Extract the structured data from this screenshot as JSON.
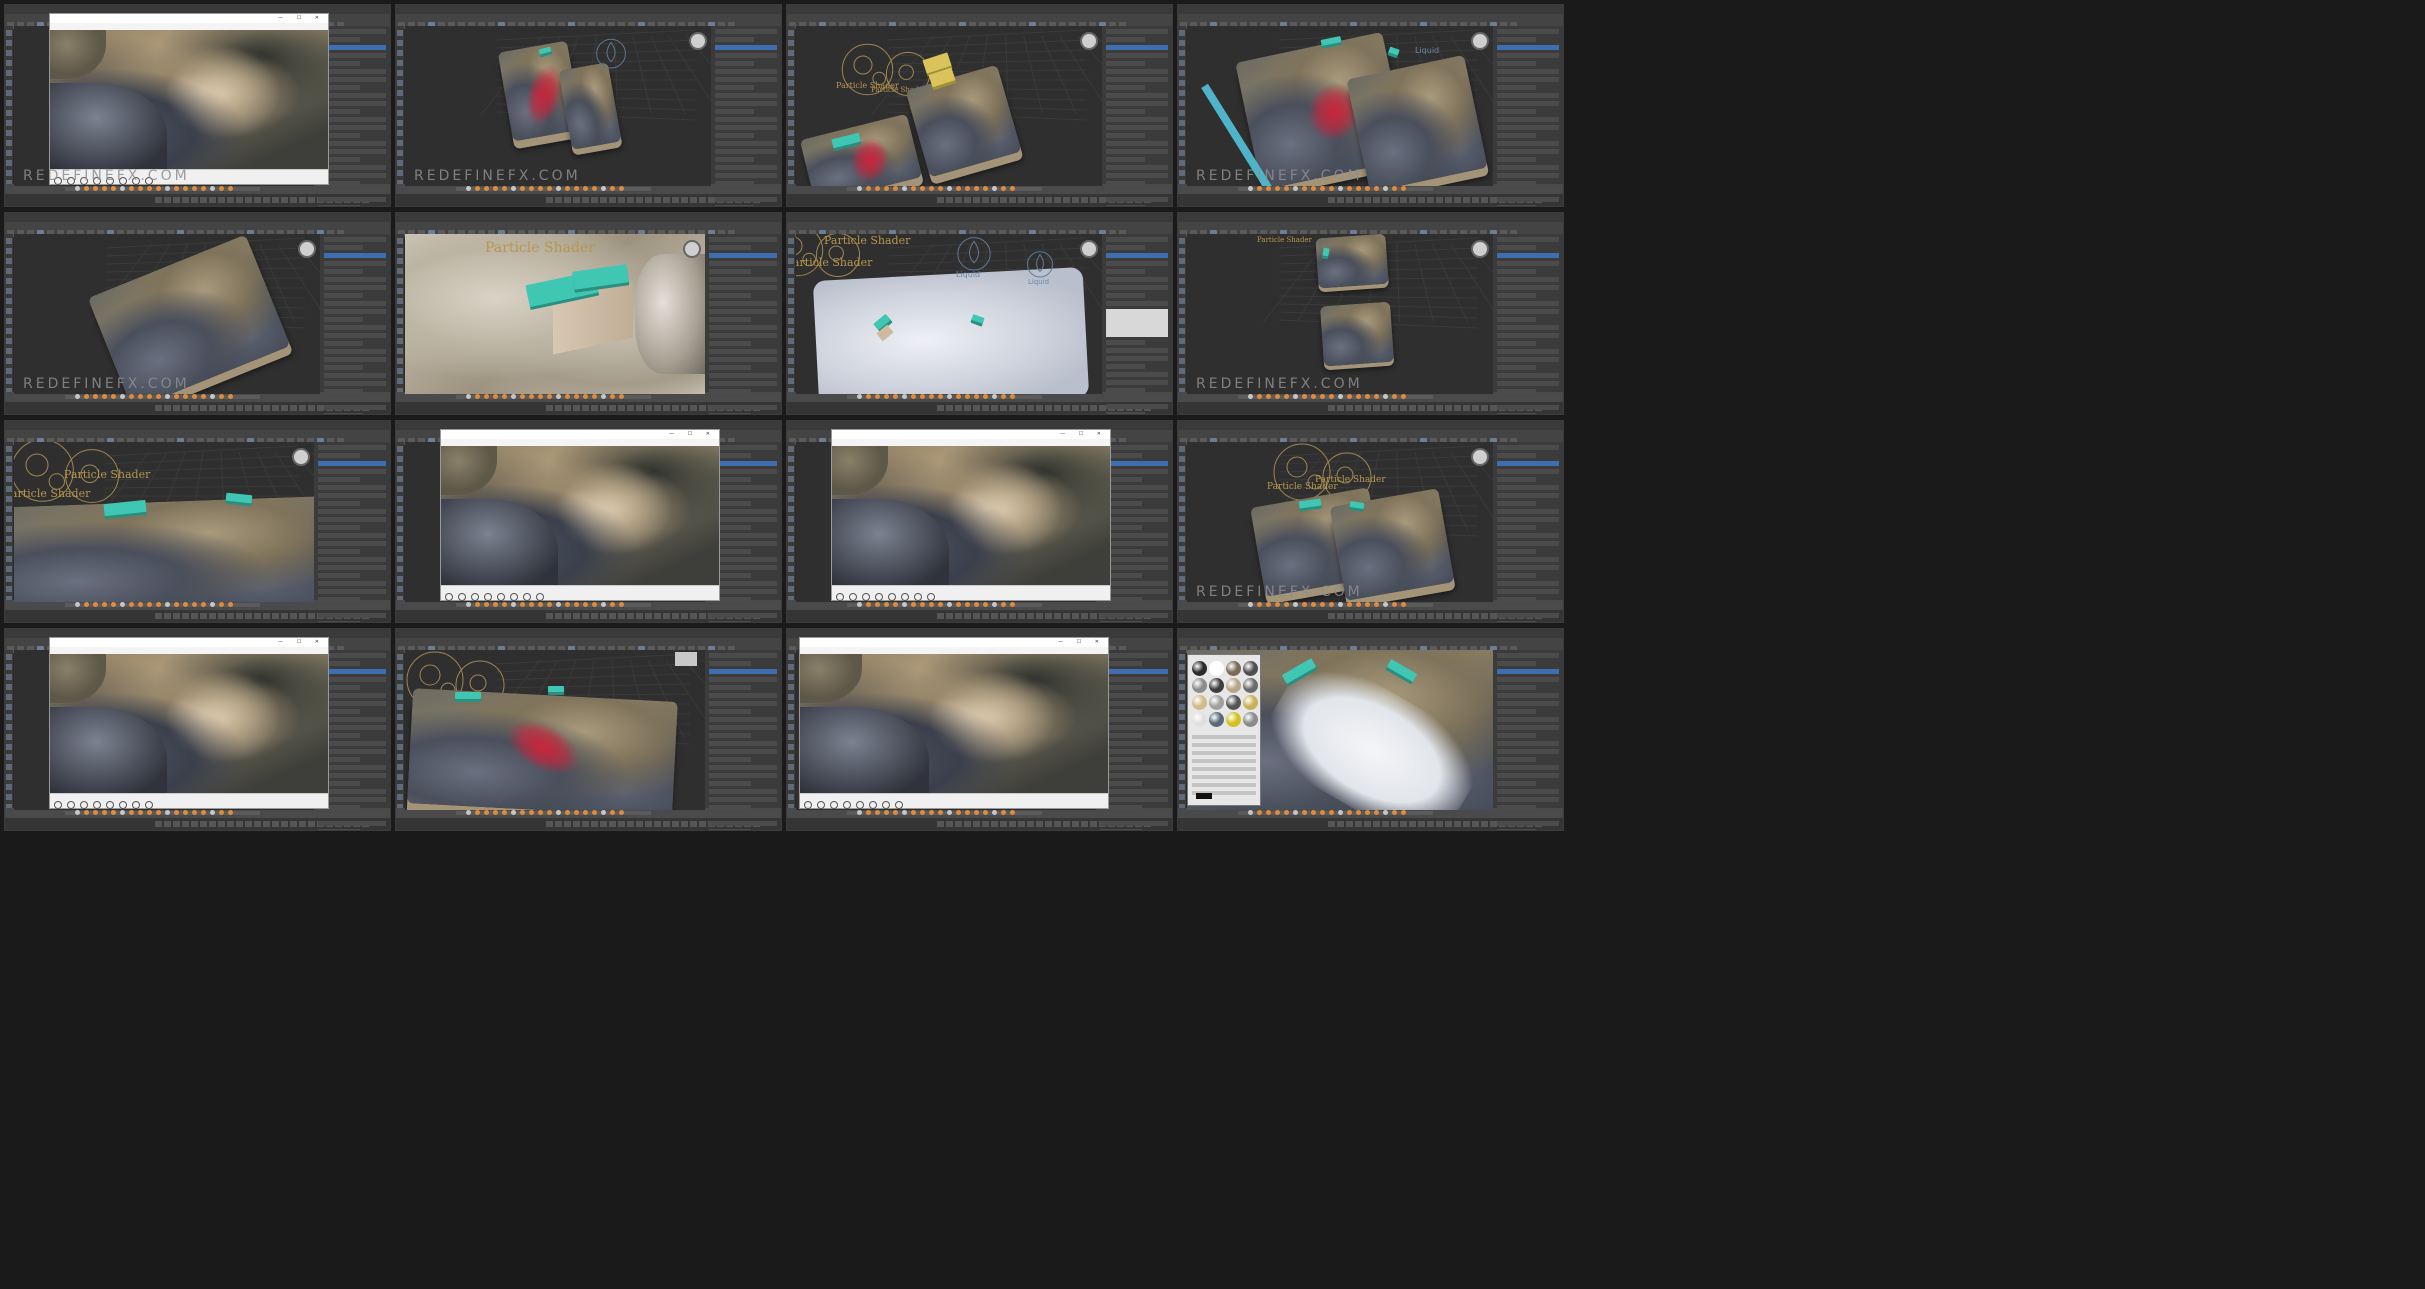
{
  "menu": [
    "File",
    "Edit",
    "Tools",
    "Group",
    "Views",
    "Create",
    "Modifiers",
    "Animation",
    "Graph Editors",
    "Rendering",
    "Civil View",
    "Customize",
    "Scripting",
    "Help"
  ],
  "player_menu": [
    "File",
    "Edit",
    "Play",
    "Navigate",
    "Favorites",
    "View",
    "Help"
  ],
  "watermark": "REDEFINEFX.COM",
  "labels": {
    "particle_shader": "Particle Shader",
    "liquid": "Liquid"
  },
  "colors": {
    "teal": "#3fc7b3",
    "particles": "#d1223a",
    "timeline_key": "#e8c34a",
    "selection_blue": "#3d6fb0"
  },
  "tiles": [
    {
      "kind": "player",
      "watermark": true
    },
    {
      "kind": "terrain",
      "variant": "small-red",
      "watermark": true
    },
    {
      "kind": "shader",
      "variant": "particles-yellow",
      "watermark": false
    },
    {
      "kind": "terrain",
      "variant": "large-teal",
      "watermark": true
    },
    {
      "kind": "terrain",
      "variant": "single",
      "watermark": true
    },
    {
      "kind": "closeup",
      "variant": "teal-box",
      "watermark": false
    },
    {
      "kind": "white",
      "variant": "liquid",
      "watermark": false
    },
    {
      "kind": "terrain",
      "variant": "two-small",
      "watermark": true
    },
    {
      "kind": "shader",
      "variant": "teal-long",
      "watermark": false
    },
    {
      "kind": "player",
      "watermark": false
    },
    {
      "kind": "player",
      "watermark": false
    },
    {
      "kind": "shader",
      "variant": "teal-right",
      "watermark": true
    },
    {
      "kind": "player",
      "watermark": false
    },
    {
      "kind": "shader",
      "variant": "particles-red",
      "watermark": false
    },
    {
      "kind": "player-large",
      "watermark": false
    },
    {
      "kind": "white",
      "variant": "material-editor",
      "watermark": false
    }
  ]
}
